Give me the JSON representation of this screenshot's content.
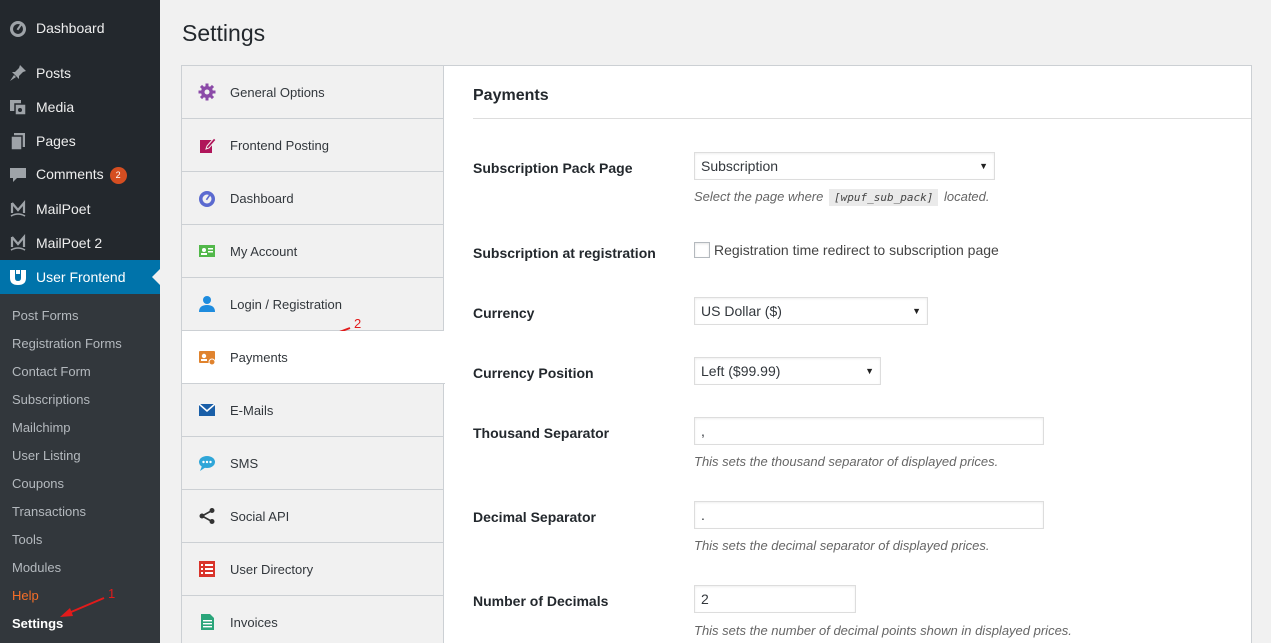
{
  "admin_menu": {
    "dashboard": "Dashboard",
    "posts": "Posts",
    "media": "Media",
    "pages": "Pages",
    "comments": "Comments",
    "comments_count": "2",
    "mailpoet": "MailPoet",
    "mailpoet2": "MailPoet 2",
    "user_frontend": "User Frontend"
  },
  "submenu": [
    "Post Forms",
    "Registration Forms",
    "Contact Form",
    "Subscriptions",
    "Mailchimp",
    "User Listing",
    "Coupons",
    "Transactions",
    "Tools",
    "Modules",
    "Help",
    "Settings"
  ],
  "page_title": "Settings",
  "tabs": [
    "General Options",
    "Frontend Posting",
    "Dashboard",
    "My Account",
    "Login / Registration",
    "Payments",
    "E-Mails",
    "SMS",
    "Social API",
    "User Directory",
    "Invoices"
  ],
  "panel": {
    "title": "Payments",
    "sub_pack_label": "Subscription Pack Page",
    "sub_pack_value": "Subscription",
    "sub_pack_desc_pre": "Select the page where",
    "sub_pack_desc_code": "[wpuf_sub_pack]",
    "sub_pack_desc_post": "located.",
    "sub_reg_label": "Subscription at registration",
    "sub_reg_check_label": "Registration time redirect to subscription page",
    "currency_label": "Currency",
    "currency_value": "US Dollar ($)",
    "currency_pos_label": "Currency Position",
    "currency_pos_value": "Left ($99.99)",
    "thousand_label": "Thousand Separator",
    "thousand_value": ",",
    "thousand_desc": "This sets the thousand separator of displayed prices.",
    "decimal_label": "Decimal Separator",
    "decimal_value": ".",
    "decimal_desc": "This sets the decimal separator of displayed prices.",
    "num_decimals_label": "Number of Decimals",
    "num_decimals_value": "2",
    "num_decimals_desc": "This sets the number of decimal points shown in displayed prices."
  },
  "annotations": {
    "one": "1",
    "two": "2",
    "color": "#e21b1b"
  },
  "colors": {
    "sidebar_bg": "#23282d",
    "submenu_bg": "#32373c",
    "accent": "#0073aa",
    "badge": "#d54e21",
    "help": "#f56e28"
  },
  "icons": [
    "dashboard-icon",
    "pin-icon",
    "media-icon",
    "pages-icon",
    "comment-icon",
    "mailpoet-icon",
    "user-frontend-icon",
    "gear-icon",
    "edit-icon",
    "dashboard-gauge-icon",
    "id-card-icon",
    "user-icon",
    "payment-icon",
    "email-icon",
    "sms-icon",
    "share-icon",
    "list-icon",
    "invoice-icon"
  ]
}
